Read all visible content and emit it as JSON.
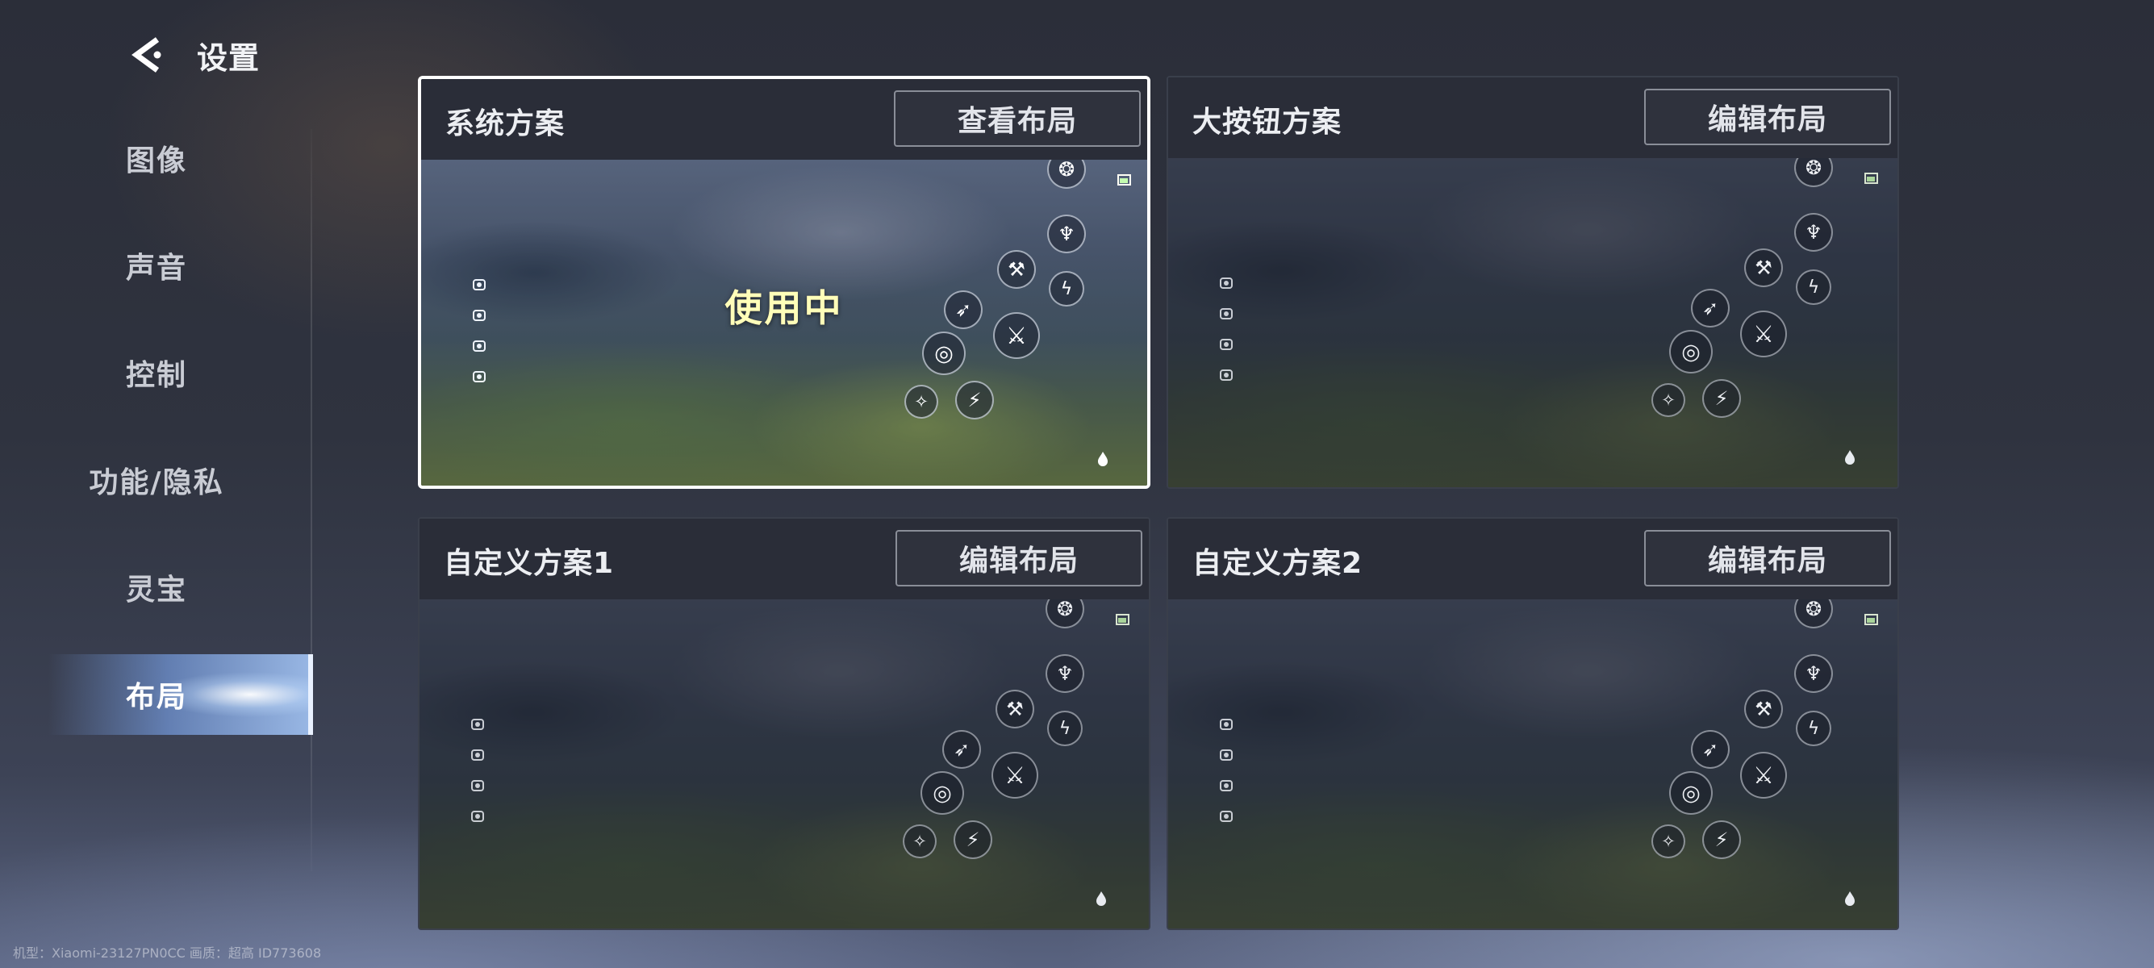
{
  "header": {
    "title": "设置",
    "back_icon": "back-arrow-icon"
  },
  "sidebar": {
    "active_index": 5,
    "items": [
      {
        "label": "图像"
      },
      {
        "label": "声音"
      },
      {
        "label": "控制"
      },
      {
        "label": "功能/隐私"
      },
      {
        "label": "灵宝"
      },
      {
        "label": "布局"
      }
    ]
  },
  "layouts": [
    {
      "title": "系统方案",
      "button_label": "查看布局",
      "selected": true,
      "status_text": "使用中"
    },
    {
      "title": "大按钮方案",
      "button_label": "编辑布局",
      "selected": false,
      "status_text": ""
    },
    {
      "title": "自定义方案1",
      "button_label": "编辑布局",
      "selected": false,
      "status_text": ""
    },
    {
      "title": "自定义方案2",
      "button_label": "编辑布局",
      "selected": false,
      "status_text": ""
    }
  ],
  "preview_icons": {
    "left_column": [
      "pencil-icon",
      "eye-icon",
      "bag-icon",
      "camera-icon"
    ],
    "skills": [
      "swirl-skill-icon",
      "trident-skill-icon",
      "hammer-skill-icon",
      "dash-skill-icon",
      "arrow-skill-icon",
      "sword-skill-icon",
      "ring-skill-icon",
      "wings-skill-icon",
      "kick-skill-icon",
      "flame-icon",
      "battery-icon"
    ]
  },
  "footer": {
    "device_info": "机型：Xiaomi-23127PN0CC 画质：超高 ID773608"
  },
  "colors": {
    "selected_border": "#ffffff",
    "status_text": "#f6dfa2",
    "active_tab_glow": "#a9c8ff"
  }
}
